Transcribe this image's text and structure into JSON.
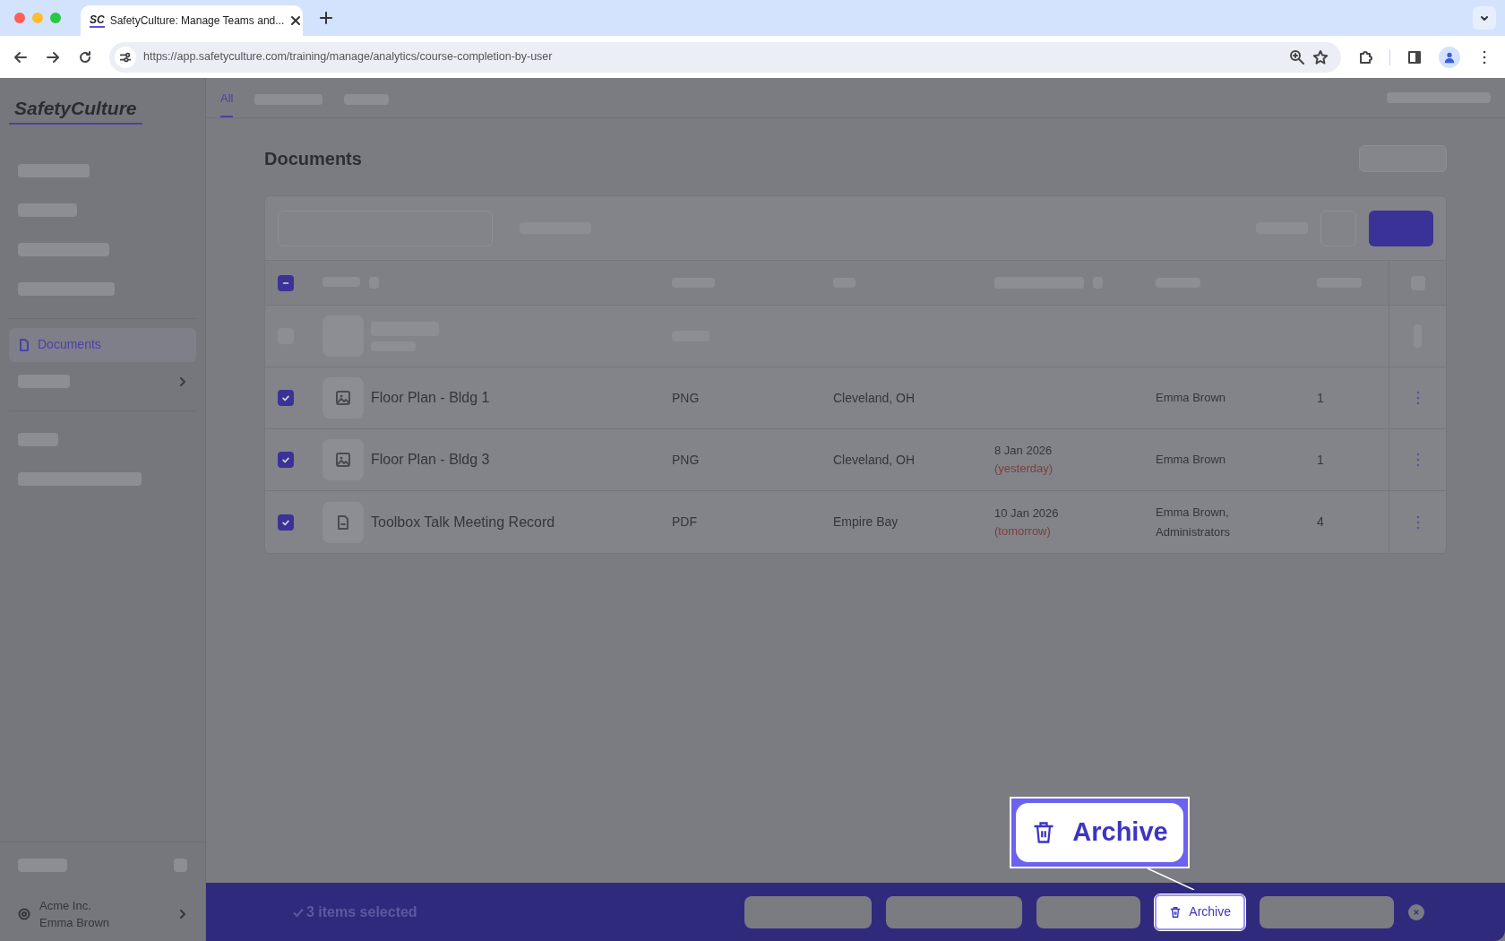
{
  "browser": {
    "favicon": "SC",
    "tab_title": "SafetyCulture: Manage Teams and...",
    "url": "https://app.safetyculture.com/training/manage/analytics/course-completion-by-user"
  },
  "sidebar": {
    "logo": "SafetyCulture",
    "active_item": "Documents",
    "org": "Acme Inc.",
    "user": "Emma Brown"
  },
  "tabs": [
    {
      "label": "All",
      "selected": true
    }
  ],
  "page_title": "Documents",
  "table": {
    "header_checkbox_indeterminate": true,
    "rows": [
      {
        "kind": "image",
        "name": "Floor Plan - Bldg 1",
        "type": "PNG",
        "location": "Cleveland, OH",
        "owner": "Emma Brown",
        "count": "1",
        "checked": true
      },
      {
        "kind": "image",
        "name": "Floor Plan - Bldg 3",
        "type": "PNG",
        "location": "Cleveland, OH",
        "date": "8 Jan 2026",
        "date_note": "(yesterday)",
        "owner": "Emma Brown",
        "count": "1",
        "checked": true
      },
      {
        "kind": "document",
        "name": "Toolbox Talk Meeting Record",
        "type": "PDF",
        "location": "Empire Bay",
        "date": "10 Jan 2026",
        "date_note": "(tomorrow)",
        "owner": "Emma Brown, Administrators",
        "count": "4",
        "checked": true
      }
    ]
  },
  "bulk_bar": {
    "selection": "3 items selected",
    "archive_button": "Archive"
  },
  "callout": {
    "label": "Archive"
  }
}
